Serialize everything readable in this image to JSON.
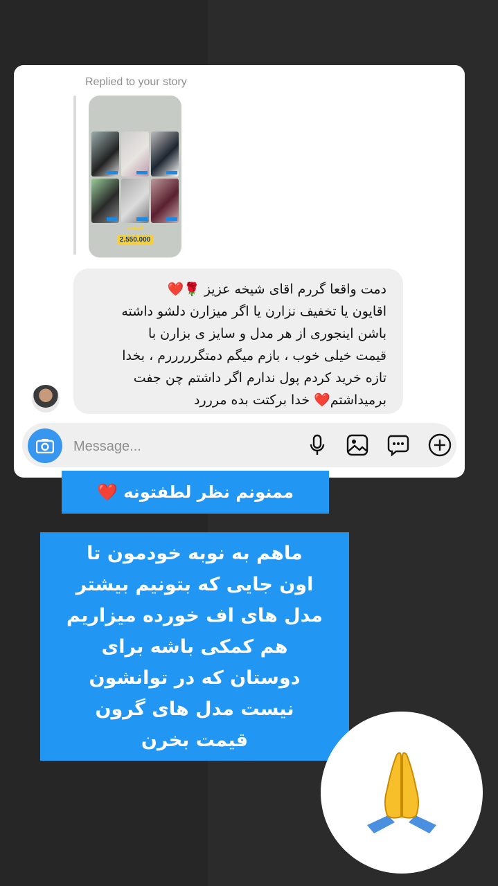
{
  "story_reply": {
    "replied_label": "Replied to your story",
    "price_label": "قیمت",
    "price_value": "2.550.000"
  },
  "message": {
    "text": "دمت واقعا گررم اقای شیخه عزیز 🌹❤️\nاقایون یا تخفیف نزارن یا اگر میزارن دلشو داشته\nباشن اینجوری از هر مدل و سایز ی بزارن با\nقیمت خیلی خوب ، بازم میگم دمتگرررررم ، بخدا\nتازه خرید کردم پول ندارم اگر داشتم چن جفت\nبرمیداشتم❤️ خدا برکتت بده مرررد"
  },
  "composer": {
    "placeholder": "Message..."
  },
  "stickers": {
    "thanks": "ممنونم  نظر  لطفتونه ❤️",
    "body": "ماهم  به  نوبه خودمون تا\nاون جایی  که  بتونیم  بیشتر\nمدل های  اف  خورده میزاریم\nهم  کمکی  باشه   برای\nدوستان  که در  توانشون\nنیست  مدل های  گرون\nقیمت  بخرن"
  },
  "emoji": "🙏",
  "colors": {
    "accent": "#3797f0",
    "sticker_bg": "#2196f3",
    "background": "#2b2b2b"
  }
}
